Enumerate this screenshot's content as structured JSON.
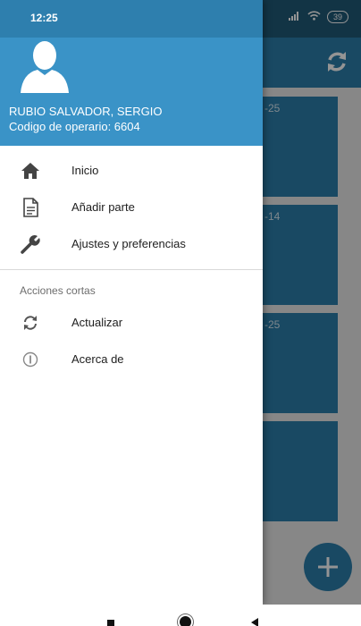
{
  "status_bar": {
    "time": "12:25",
    "battery": "39"
  },
  "background": {
    "card_labels": [
      "-25",
      "-14",
      "-25"
    ]
  },
  "drawer": {
    "user_name": "RUBIO SALVADOR, SERGIO",
    "operator_line": "Codigo de operario:  6604",
    "menu_items": [
      {
        "label": "Inicio",
        "icon": "home-icon"
      },
      {
        "label": "Añadir parte",
        "icon": "document-icon"
      },
      {
        "label": "Ajustes y preferencias",
        "icon": "wrench-icon"
      }
    ],
    "section_title": "Acciones cortas",
    "short_actions": [
      {
        "label": "Actualizar",
        "icon": "refresh-icon"
      },
      {
        "label": "Acerca de",
        "icon": "info-icon"
      }
    ]
  },
  "colors": {
    "header": "#3a93c7",
    "status_bar": "#2e7fae",
    "accent": "#2b7eab"
  }
}
